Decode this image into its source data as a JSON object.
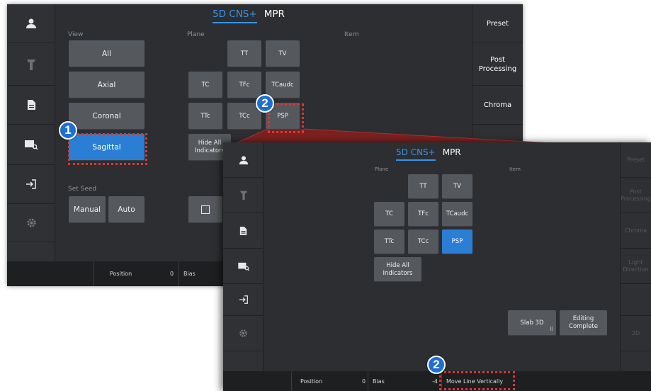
{
  "window1": {
    "tabs": [
      "5D CNS+",
      "MPR"
    ],
    "sections": {
      "view": "View",
      "plane": "Plane",
      "item": "Item",
      "set_seed": "Set Seed"
    },
    "view_buttons": [
      "All",
      "Axial",
      "Coronal",
      "Sagittal"
    ],
    "plane_buttons": {
      "tt": "TT",
      "tv": "TV",
      "tc": "TC",
      "tfc": "TFc",
      "tcaudc": "TCaudc",
      "ttc": "TTc",
      "tcc": "TCc",
      "psp": "PSP",
      "hide_all": "Hide All Indicators"
    },
    "seed_buttons": [
      "Manual",
      "Auto"
    ],
    "right_menu": [
      "Preset",
      "Post Processing",
      "Chroma"
    ],
    "status": {
      "position_label": "Position",
      "position_value": "0",
      "bias_label": "Bias"
    }
  },
  "window2": {
    "tabs": [
      "5D CNS+",
      "MPR"
    ],
    "sections": {
      "plane": "Plane",
      "item": "Item"
    },
    "plane_buttons": {
      "tt": "TT",
      "tv": "TV",
      "tc": "TC",
      "tfc": "TFc",
      "tcaudc": "TCaudc",
      "ttc": "TTc",
      "tcc": "TCc",
      "psp": "PSP",
      "hide_all": "Hide All Indicators"
    },
    "action_buttons": {
      "slab": "Slab 3D",
      "editing": "Editing Complete"
    },
    "right_menu": [
      "Preset",
      "Post Processing",
      "Chroma",
      "Light Direction",
      "",
      "2D"
    ],
    "status": {
      "position_label": "Position",
      "position_value": "0",
      "bias_label": "Bias",
      "bias_value": "-4",
      "move_line": "Move Line Vertically"
    }
  },
  "markers": {
    "m1": "1",
    "m2": "2",
    "m3": "2"
  },
  "colors": {
    "accent": "#2a7fd4",
    "highlight": "#e0352f",
    "panel": "#2c2e31"
  }
}
